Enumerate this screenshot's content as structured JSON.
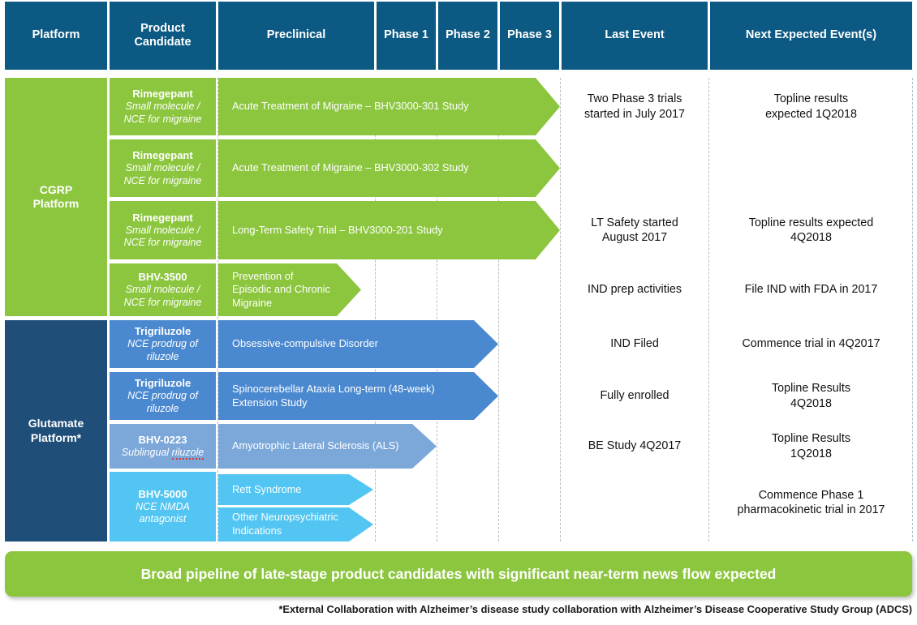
{
  "header": {
    "columns": [
      {
        "label": "Platform"
      },
      {
        "label": "Product\nCandidate"
      },
      {
        "label": "Preclinical"
      },
      {
        "label": "Phase 1"
      },
      {
        "label": "Phase 2"
      },
      {
        "label": "Phase 3"
      },
      {
        "label": "Last Event"
      },
      {
        "label": "Next Expected Event(s)"
      }
    ]
  },
  "colors": {
    "header_blue": "#0c5a83",
    "cgrp_green": "#8cc63f",
    "glutamate_navy": "#1f4e79",
    "arrow_green": "#8cc63f",
    "arrow_blue": "#4a89d0",
    "arrow_blue_light": "#7ba7d9",
    "arrow_cyan": "#52c5f2",
    "banner_green": "#8cc63f",
    "text_white": "#ffffff",
    "text_dark": "#111111",
    "dash_line": "#b9bcc0",
    "spellcheck_red": "#e03030"
  },
  "platforms": [
    {
      "name": "CGRP\nPlatform",
      "label_line1": "CGRP",
      "label_line2": "Platform",
      "color": "#8cc63f"
    },
    {
      "name": "Glutamate\nPlatform*",
      "label_line1": "Glutamate",
      "label_line2": "Platform*",
      "color": "#1f4e79"
    }
  ],
  "rows": [
    {
      "candidate": "Rimegepant",
      "candidate_sub_line1": "Small molecule /",
      "candidate_sub_line2": "NCE for migraine",
      "candidate_bg": "#8cc63f",
      "program": "Acute Treatment of Migraine – BHV3000-301 Study",
      "arrow_bg": "#8cc63f",
      "arrow_stage": "Phase 3",
      "last_event": "Two Phase 3 trials\nstarted in July 2017",
      "next_event": "Topline results\nexpected 1Q2018"
    },
    {
      "candidate": "Rimegepant",
      "candidate_sub_line1": "Small molecule /",
      "candidate_sub_line2": "NCE for migraine",
      "candidate_bg": "#8cc63f",
      "program": "Acute Treatment of Migraine – BHV3000-302 Study",
      "arrow_bg": "#8cc63f",
      "arrow_stage": "Phase 3",
      "last_event": "",
      "next_event": ""
    },
    {
      "candidate": "Rimegepant",
      "candidate_sub_line1": "Small molecule /",
      "candidate_sub_line2": "NCE for migraine",
      "candidate_bg": "#8cc63f",
      "program": "Long-Term Safety Trial – BHV3000-201 Study",
      "arrow_bg": "#8cc63f",
      "arrow_stage": "Phase 3",
      "last_event": "LT Safety started\nAugust 2017",
      "next_event": "Topline results expected\n4Q2018"
    },
    {
      "candidate": "BHV-3500",
      "candidate_sub_line1": "Small molecule /",
      "candidate_sub_line2": "NCE for migraine",
      "candidate_bg": "#8cc63f",
      "program": "Prevention of  Episodic and Chronic Migraine",
      "arrow_bg": "#8cc63f",
      "arrow_stage": "Preclinical",
      "last_event": "IND prep activities",
      "next_event": "File IND with FDA in 2017"
    },
    {
      "candidate": "Trigriluzole",
      "candidate_sub_line1": "NCE prodrug of",
      "candidate_sub_line2": "riluzole",
      "candidate_bg": "#4a89d0",
      "program": "Obsessive-compulsive Disorder",
      "arrow_bg": "#4a89d0",
      "arrow_stage": "Phase 2",
      "last_event": "IND Filed",
      "next_event": "Commence trial in 4Q2017"
    },
    {
      "candidate": "Trigriluzole",
      "candidate_sub_line1": "NCE prodrug of",
      "candidate_sub_line2": "riluzole",
      "candidate_bg": "#4a89d0",
      "program": "Spinocerebellar Ataxia Long-term (48-week) Extension Study",
      "arrow_bg": "#4a89d0",
      "arrow_stage": "Phase 2",
      "last_event": "Fully enrolled",
      "next_event": "Topline Results\n4Q2018"
    },
    {
      "candidate": "BHV-0223",
      "candidate_sub_line1": "Sublingual ",
      "candidate_sub_line2": "riluzole",
      "candidate_sub_spellcheck": true,
      "candidate_bg": "#7ba7d9",
      "program": "Amyotrophic Lateral Sclerosis (ALS)",
      "arrow_bg": "#7ba7d9",
      "arrow_stage": "Phase 1",
      "last_event": "BE Study 4Q2017",
      "next_event": "Topline Results\n1Q2018"
    },
    {
      "candidate": "BHV-5000",
      "candidate_sub_line1": "NCE NMDA",
      "candidate_sub_line2": "antagonist",
      "candidate_bg": "#52c5f2",
      "programs": [
        {
          "program": "Rett Syndrome",
          "arrow_bg": "#52c5f2",
          "arrow_stage": "Preclinical"
        },
        {
          "program": "Other Neuropsychiatric Indications",
          "arrow_bg": "#52c5f2",
          "arrow_stage": "Preclinical"
        }
      ],
      "last_event": "",
      "next_event": "Commence Phase 1\npharmacokinetic trial in 2017"
    }
  ],
  "banner": {
    "text": "Broad pipeline of late-stage product candidates with significant near-term news flow expected"
  },
  "footnote": {
    "text": "*External Collaboration with Alzheimer’s disease study collaboration with Alzheimer’s Disease Cooperative Study Group (ADCS)"
  }
}
